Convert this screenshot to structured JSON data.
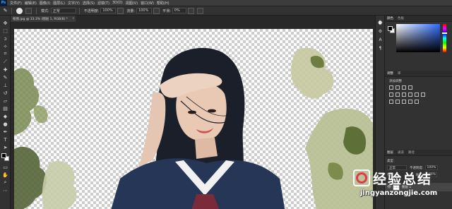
{
  "menubar": {
    "logo": "Ps",
    "items": [
      "文件(F)",
      "编辑(E)",
      "图像(I)",
      "图层(L)",
      "文字(Y)",
      "选择(S)",
      "滤镜(T)",
      "3D(D)",
      "视图(V)",
      "窗口(W)",
      "帮助(H)"
    ]
  },
  "options": {
    "mode_label": "模式:",
    "mode_value": "正常",
    "opacity_label": "不透明度:",
    "opacity_value": "100%",
    "flow_label": "流量:",
    "flow_value": "100%",
    "smooth_label": "平滑:",
    "smooth_value": "0%"
  },
  "document": {
    "tab_title": "抠图.jpg @ 33.3% (图层 1, RGB/8) *",
    "close_glyph": "×"
  },
  "panels": {
    "color_tabs": [
      "颜色",
      "色板"
    ],
    "adjust_tabs": [
      "调整",
      "库"
    ],
    "adjust_add_label": "添加调整",
    "layers_tabs": [
      "图层",
      "通道",
      "路径"
    ],
    "kind_label": "类型",
    "blend_value": "正常",
    "opacity_label": "不透明度:",
    "opacity_value": "100%",
    "lock_label": "锁定:",
    "fill_label": "填充:",
    "fill_value": "100%",
    "layer_name": "图层 1",
    "eye_glyph": "👁"
  },
  "watermark": {
    "brand": "经验总结",
    "url": "jingyanzongjie.com"
  },
  "colors": {
    "foreground": "#000000",
    "background": "#ffffff",
    "accent": "#31a8ff"
  },
  "icons": {
    "tools": [
      "move-icon",
      "marquee-icon",
      "lasso-icon",
      "quick-select-icon",
      "crop-icon",
      "eyedropper-icon",
      "healing-icon",
      "brush-icon",
      "stamp-icon",
      "history-brush-icon",
      "eraser-icon",
      "gradient-icon",
      "blur-icon",
      "dodge-icon",
      "pen-icon",
      "type-icon",
      "path-select-icon",
      "shape-icon",
      "hand-icon",
      "zoom-icon",
      "more-tools-icon"
    ]
  }
}
